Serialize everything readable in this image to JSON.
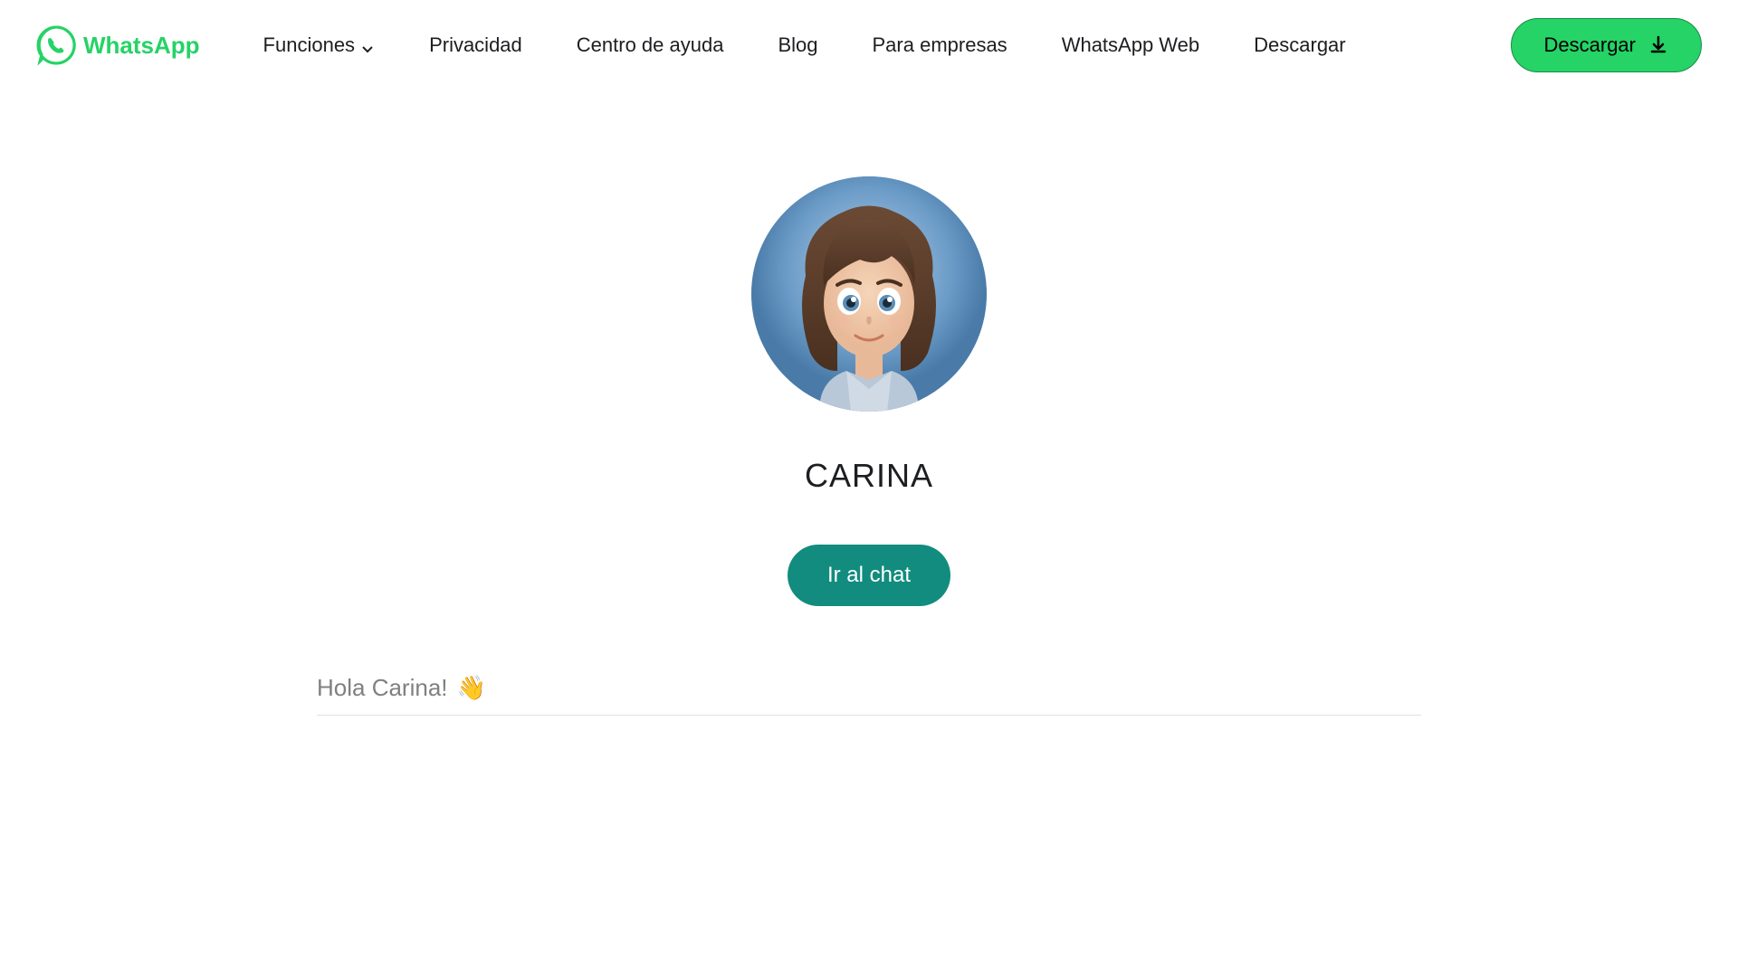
{
  "header": {
    "logo_text": "WhatsApp",
    "nav": {
      "funciones": "Funciones",
      "privacidad": "Privacidad",
      "centro_ayuda": "Centro de ayuda",
      "blog": "Blog",
      "para_empresas": "Para empresas",
      "whatsapp_web": "WhatsApp Web",
      "descargar_link": "Descargar"
    },
    "download_button": "Descargar"
  },
  "profile": {
    "name": "CARINA",
    "chat_button": "Ir al chat",
    "greeting": "Hola Carina!",
    "greeting_emoji": "👋"
  }
}
